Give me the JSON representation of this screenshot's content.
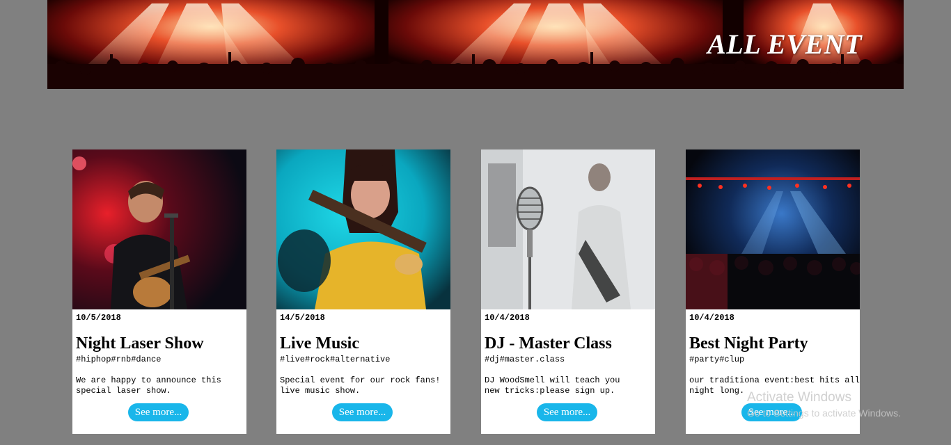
{
  "banner": {
    "title": "ALL EVENT"
  },
  "events": [
    {
      "date": "10/5/2018",
      "title": "Night Laser Show",
      "tags": "#hiphop#rnb#dance",
      "description_line1": "We are happy to announce this",
      "description_line2": "special laser show.",
      "button_label": "See more..."
    },
    {
      "date": "14/5/2018",
      "title": "Live Music",
      "tags": "#live#rock#alternative",
      "description_line1": "Special event for our rock fans!",
      "description_line2": "live music show.",
      "button_label": "See more..."
    },
    {
      "date": "10/4/2018",
      "title": "DJ - Master Class",
      "tags": "#dj#master.class",
      "description_line1": "DJ WoodSmell will teach you",
      "description_line2": "new tricks:please sign up.",
      "button_label": "See more..."
    },
    {
      "date": "10/4/2018",
      "title": "Best Night Party",
      "tags": "#party#clup",
      "description_line1": "our traditiona event:best hits all",
      "description_line2": "night long.",
      "button_label": "See more..."
    }
  ],
  "watermark": {
    "title": "Activate Windows",
    "subtitle": "Go to Settings to activate Windows."
  },
  "colors": {
    "page_background": "#808080",
    "button": "#19b6ea",
    "card": "#ffffff"
  }
}
